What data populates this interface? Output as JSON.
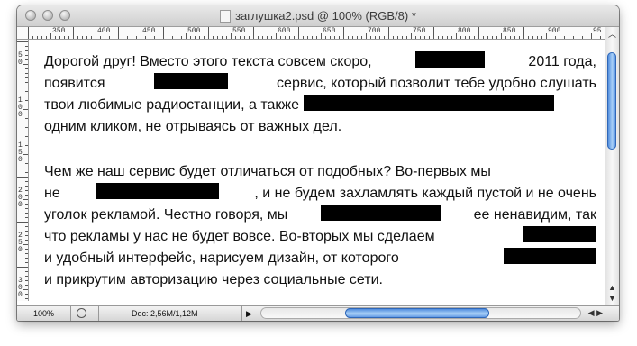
{
  "window": {
    "title": "заглушка2.psd @ 100% (RGB/8) *"
  },
  "ruler": {
    "top_labels": [
      "350",
      "400",
      "450",
      "500",
      "550",
      "600",
      "650",
      "700",
      "750",
      "800",
      "850",
      "900",
      "95"
    ],
    "left_labels": [
      "50",
      "100",
      "150",
      "200",
      "250",
      "300"
    ]
  },
  "document": {
    "paragraph1": {
      "line1": {
        "a": "Дорогой друг! Вместо этого текста совсем скоро,",
        "b": "2011 года,"
      },
      "line2": {
        "a": "появится",
        "b": "сервис, который позволит тебе удобно слушать"
      },
      "line3": {
        "a": "твои любимые радиостанции, а также"
      },
      "line4": {
        "a": "одним кликом, не отрываясь от важных дел."
      }
    },
    "paragraph2": {
      "line1": {
        "a": "Чем же наш сервис будет отличаться от подобных? Во-первых мы"
      },
      "line2": {
        "a": "не",
        "b": ", и не будем захламлять каждый пустой и не очень"
      },
      "line3": {
        "a": "уголок рекламой. Честно говоря, мы",
        "b": "ее ненавидим, так"
      },
      "line4": {
        "a": "что рекламы у нас не будет вовсе. Во-вторых мы сделаем"
      },
      "line5": {
        "a": "и удобный интерфейс, нарисуем дизайн, от которого"
      },
      "line6": {
        "a": "и прикрутим авторизацию через социальные сети."
      }
    }
  },
  "statusbar": {
    "zoom": "100%",
    "doc_info": "Doc: 2,56M/1,12M"
  },
  "colors": {
    "redaction": "#000000",
    "scroll_thumb": "#4f8be0"
  }
}
